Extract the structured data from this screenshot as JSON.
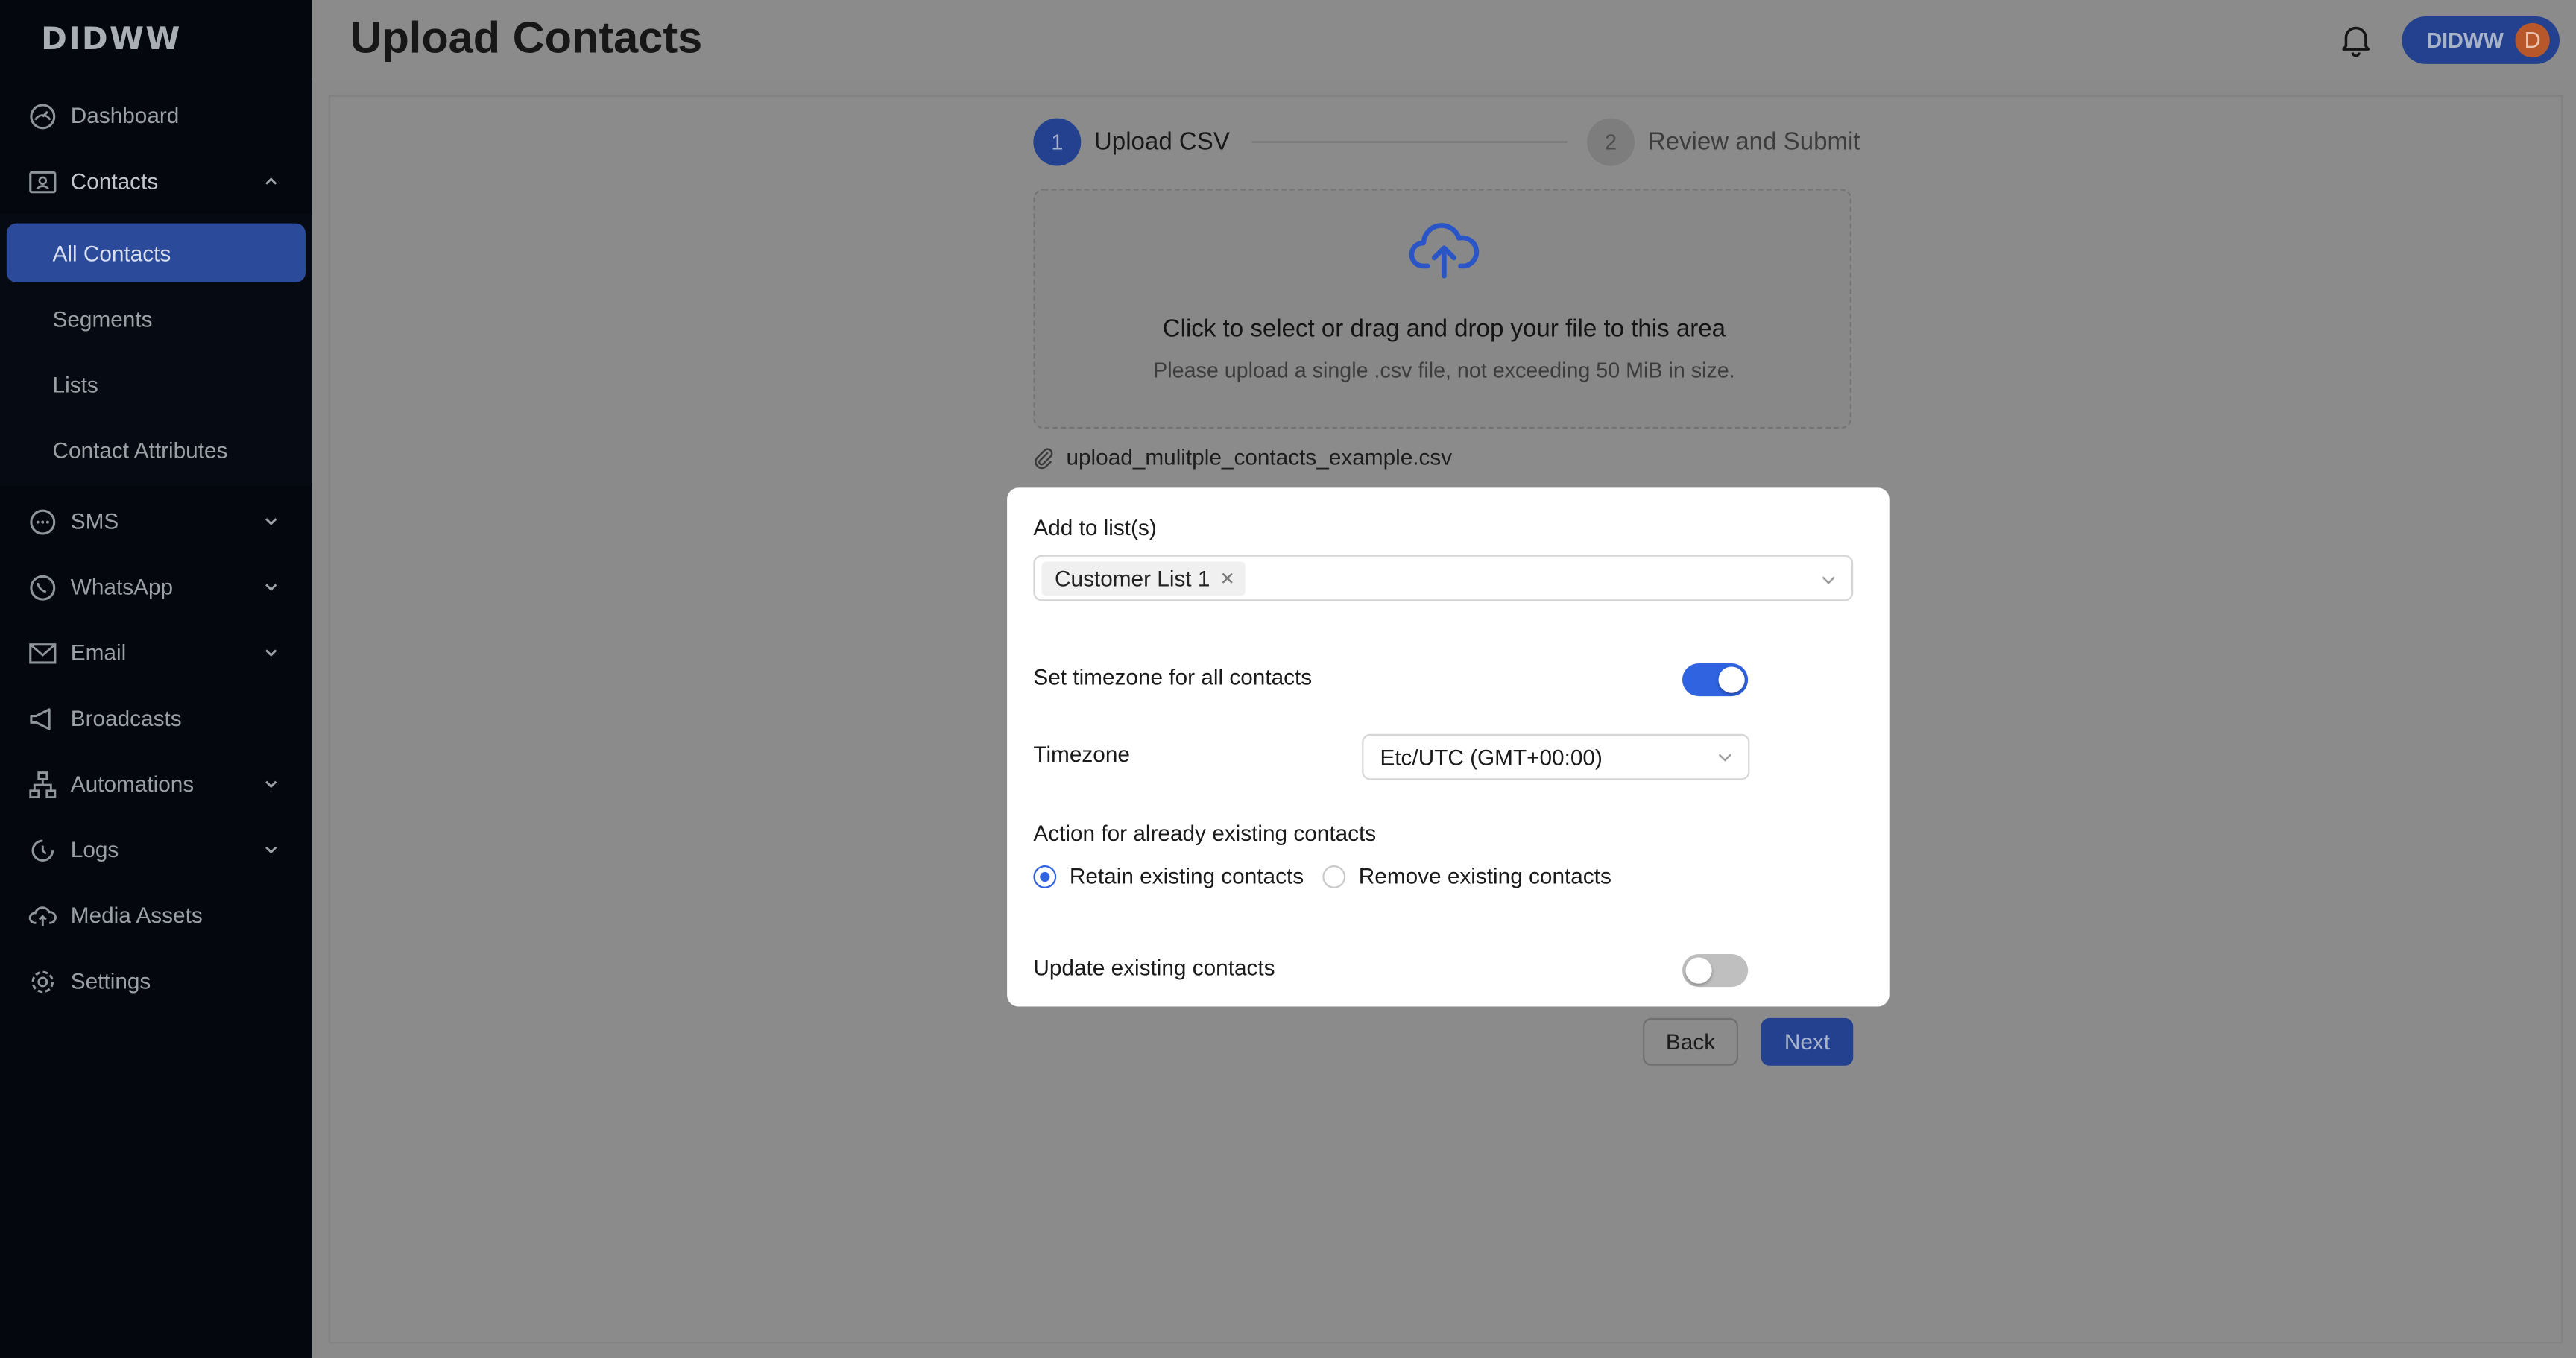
{
  "app": {
    "logo": "DIDWW"
  },
  "sidebar": {
    "items": [
      {
        "label": "Dashboard",
        "icon": "dashboard-icon"
      },
      {
        "label": "Contacts",
        "icon": "contacts-icon",
        "expanded": true
      },
      {
        "label": "SMS",
        "icon": "sms-icon"
      },
      {
        "label": "WhatsApp",
        "icon": "whatsapp-icon"
      },
      {
        "label": "Email",
        "icon": "email-icon"
      },
      {
        "label": "Broadcasts",
        "icon": "broadcast-icon"
      },
      {
        "label": "Automations",
        "icon": "automations-icon"
      },
      {
        "label": "Logs",
        "icon": "logs-icon"
      },
      {
        "label": "Media Assets",
        "icon": "media-assets-icon"
      },
      {
        "label": "Settings",
        "icon": "gear-icon"
      }
    ],
    "contacts_sub": [
      {
        "label": "All Contacts",
        "active": true
      },
      {
        "label": "Segments"
      },
      {
        "label": "Lists"
      },
      {
        "label": "Contact Attributes"
      }
    ]
  },
  "header": {
    "title": "Upload Contacts",
    "user": {
      "name": "DIDWW",
      "initial": "D"
    }
  },
  "steps": [
    {
      "number": "1",
      "label": "Upload CSV"
    },
    {
      "number": "2",
      "label": "Review and Submit"
    }
  ],
  "upload": {
    "title": "Click to select or drag and drop your file to this area",
    "hint": "Please upload a single .csv file, not exceeding 50 MiB in size.",
    "file_name": "upload_mulitple_contacts_example.csv"
  },
  "modal": {
    "add_to_lists_label": "Add to list(s)",
    "selected_list": "Customer List 1",
    "set_timezone_label": "Set timezone for all contacts",
    "set_timezone_on": true,
    "timezone_label": "Timezone",
    "timezone_value": "Etc/UTC (GMT+00:00)",
    "existing_action_label": "Action for already existing contacts",
    "retain_label": "Retain existing contacts",
    "remove_label": "Remove existing contacts",
    "selected_action": "retain",
    "update_existing_label": "Update existing contacts",
    "update_existing_on": false
  },
  "buttons": {
    "back": "Back",
    "next": "Next"
  },
  "colors": {
    "accent": "#2f63e0",
    "primary_dark": "#23418f",
    "sidebar_bg": "#04070d"
  }
}
